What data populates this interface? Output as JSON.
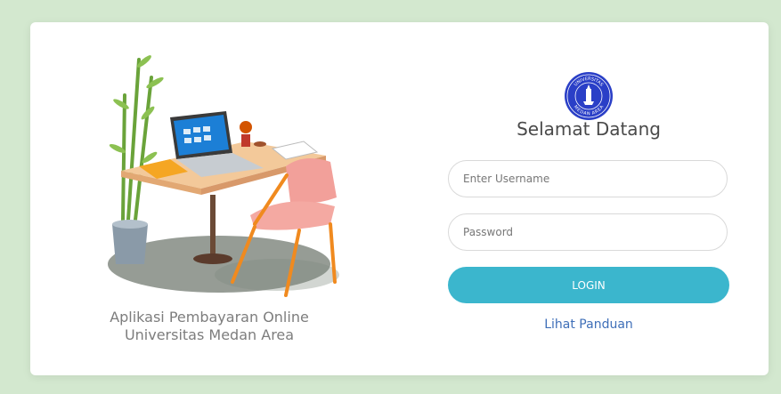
{
  "app": {
    "caption_line1": "Aplikasi Pembayaran Online",
    "caption_line2": "Universitas Medan Area"
  },
  "login": {
    "welcome_title": "Selamat Datang",
    "username_placeholder": "Enter Username",
    "password_placeholder": "Password",
    "login_label": "LOGIN",
    "guide_link_label": "Lihat Panduan"
  },
  "logo": {
    "icon": "university-seal-icon",
    "seal_text_top": "UNIVERSITAS",
    "seal_text_bottom": "MEDAN AREA"
  },
  "colors": {
    "background": "#d3e8cf",
    "card": "#ffffff",
    "accent": "#3bb6cd",
    "link": "#3f6fb8",
    "seal": "#2a3fc7"
  }
}
